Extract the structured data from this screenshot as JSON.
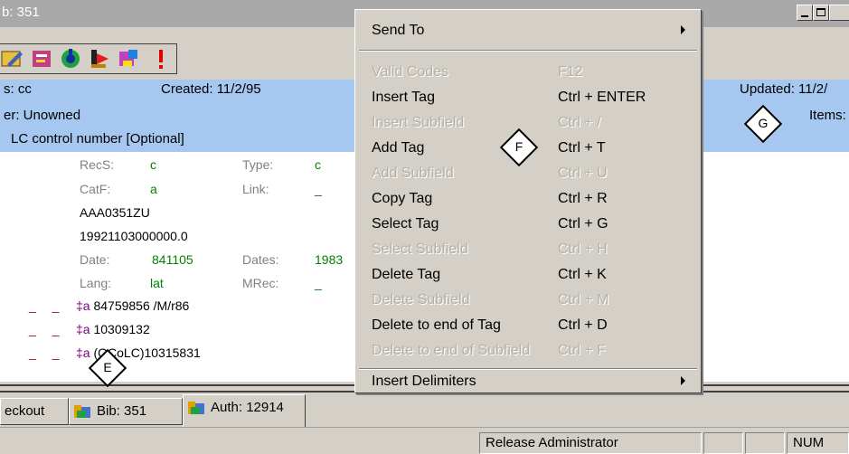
{
  "window": {
    "title": "b: 351",
    "min_glyph": "_",
    "max_glyph": "",
    "close_glyph": ""
  },
  "header": {
    "type_label": "s: cc",
    "created": "Created: 11/2/95",
    "owner": "er: Unowned",
    "field_desc": "LC control number [Optional]",
    "updated": "Updated: 11/2/",
    "items": "Items:"
  },
  "fields": {
    "recs_label": "RecS:",
    "recs_val": "c",
    "type_label": "Type:",
    "type_val": "c",
    "catf_label": "CatF:",
    "catf_val": "a",
    "link_label": "Link:",
    "link_val": "_",
    "control_no": "AAA0351ZU",
    "timestamp": "19921103000000.0",
    "date_label": "Date:",
    "date_val": "841105",
    "dates_label": "Dates:",
    "dates_val": "1983",
    "lang_label": "Lang:",
    "lang_val": "lat",
    "mrec_label": "MRec:",
    "mrec_val": "_",
    "rows": [
      {
        "dashes": "_ _",
        "delim": "‡a",
        "text": " 84759856 /M/r86"
      },
      {
        "dashes": "_ _",
        "delim": "‡a",
        "text": " 10309132"
      },
      {
        "dashes": "_ _",
        "delim": "‡a",
        "text": " (OCoLC)10315831"
      }
    ]
  },
  "menu": {
    "send_to": "Send To",
    "items": [
      {
        "label": "Valid Codes",
        "shortcut": "F12",
        "enabled": false
      },
      {
        "label": "Insert Tag",
        "shortcut": "Ctrl + ENTER",
        "enabled": true
      },
      {
        "label": "Insert Subfield",
        "shortcut": "Ctrl + /",
        "enabled": false
      },
      {
        "label": "Add Tag",
        "shortcut": "Ctrl + T",
        "enabled": true
      },
      {
        "label": "Add Subfield",
        "shortcut": "Ctrl + U",
        "enabled": false
      },
      {
        "label": "Copy Tag",
        "shortcut": "Ctrl + R",
        "enabled": true
      },
      {
        "label": "Select Tag",
        "shortcut": "Ctrl + G",
        "enabled": true
      },
      {
        "label": "Select Subfield",
        "shortcut": "Ctrl + H",
        "enabled": false
      },
      {
        "label": "Delete Tag",
        "shortcut": "Ctrl + K",
        "enabled": true
      },
      {
        "label": "Delete Subfield",
        "shortcut": "Ctrl + M",
        "enabled": false
      },
      {
        "label": "Delete to end of Tag",
        "shortcut": "Ctrl + D",
        "enabled": true
      },
      {
        "label": "Delete to end of Subfield",
        "shortcut": "Ctrl + F",
        "enabled": false
      }
    ],
    "insert_delimiters": "Insert Delimiters"
  },
  "tabs": [
    {
      "label": "eckout",
      "icon": ""
    },
    {
      "label": "Bib: 351",
      "icon": "bib-icon"
    },
    {
      "label": "Auth: 12914",
      "icon": "auth-icon"
    }
  ],
  "status": {
    "message": "Release Administrator",
    "num": "NUM"
  },
  "callouts": {
    "e": "E",
    "f": "F",
    "g": "G"
  },
  "toolbar_icons": [
    "edit-icon",
    "tag-icon",
    "refresh-icon",
    "bookmark-icon",
    "paint-icon",
    "alert-icon"
  ]
}
